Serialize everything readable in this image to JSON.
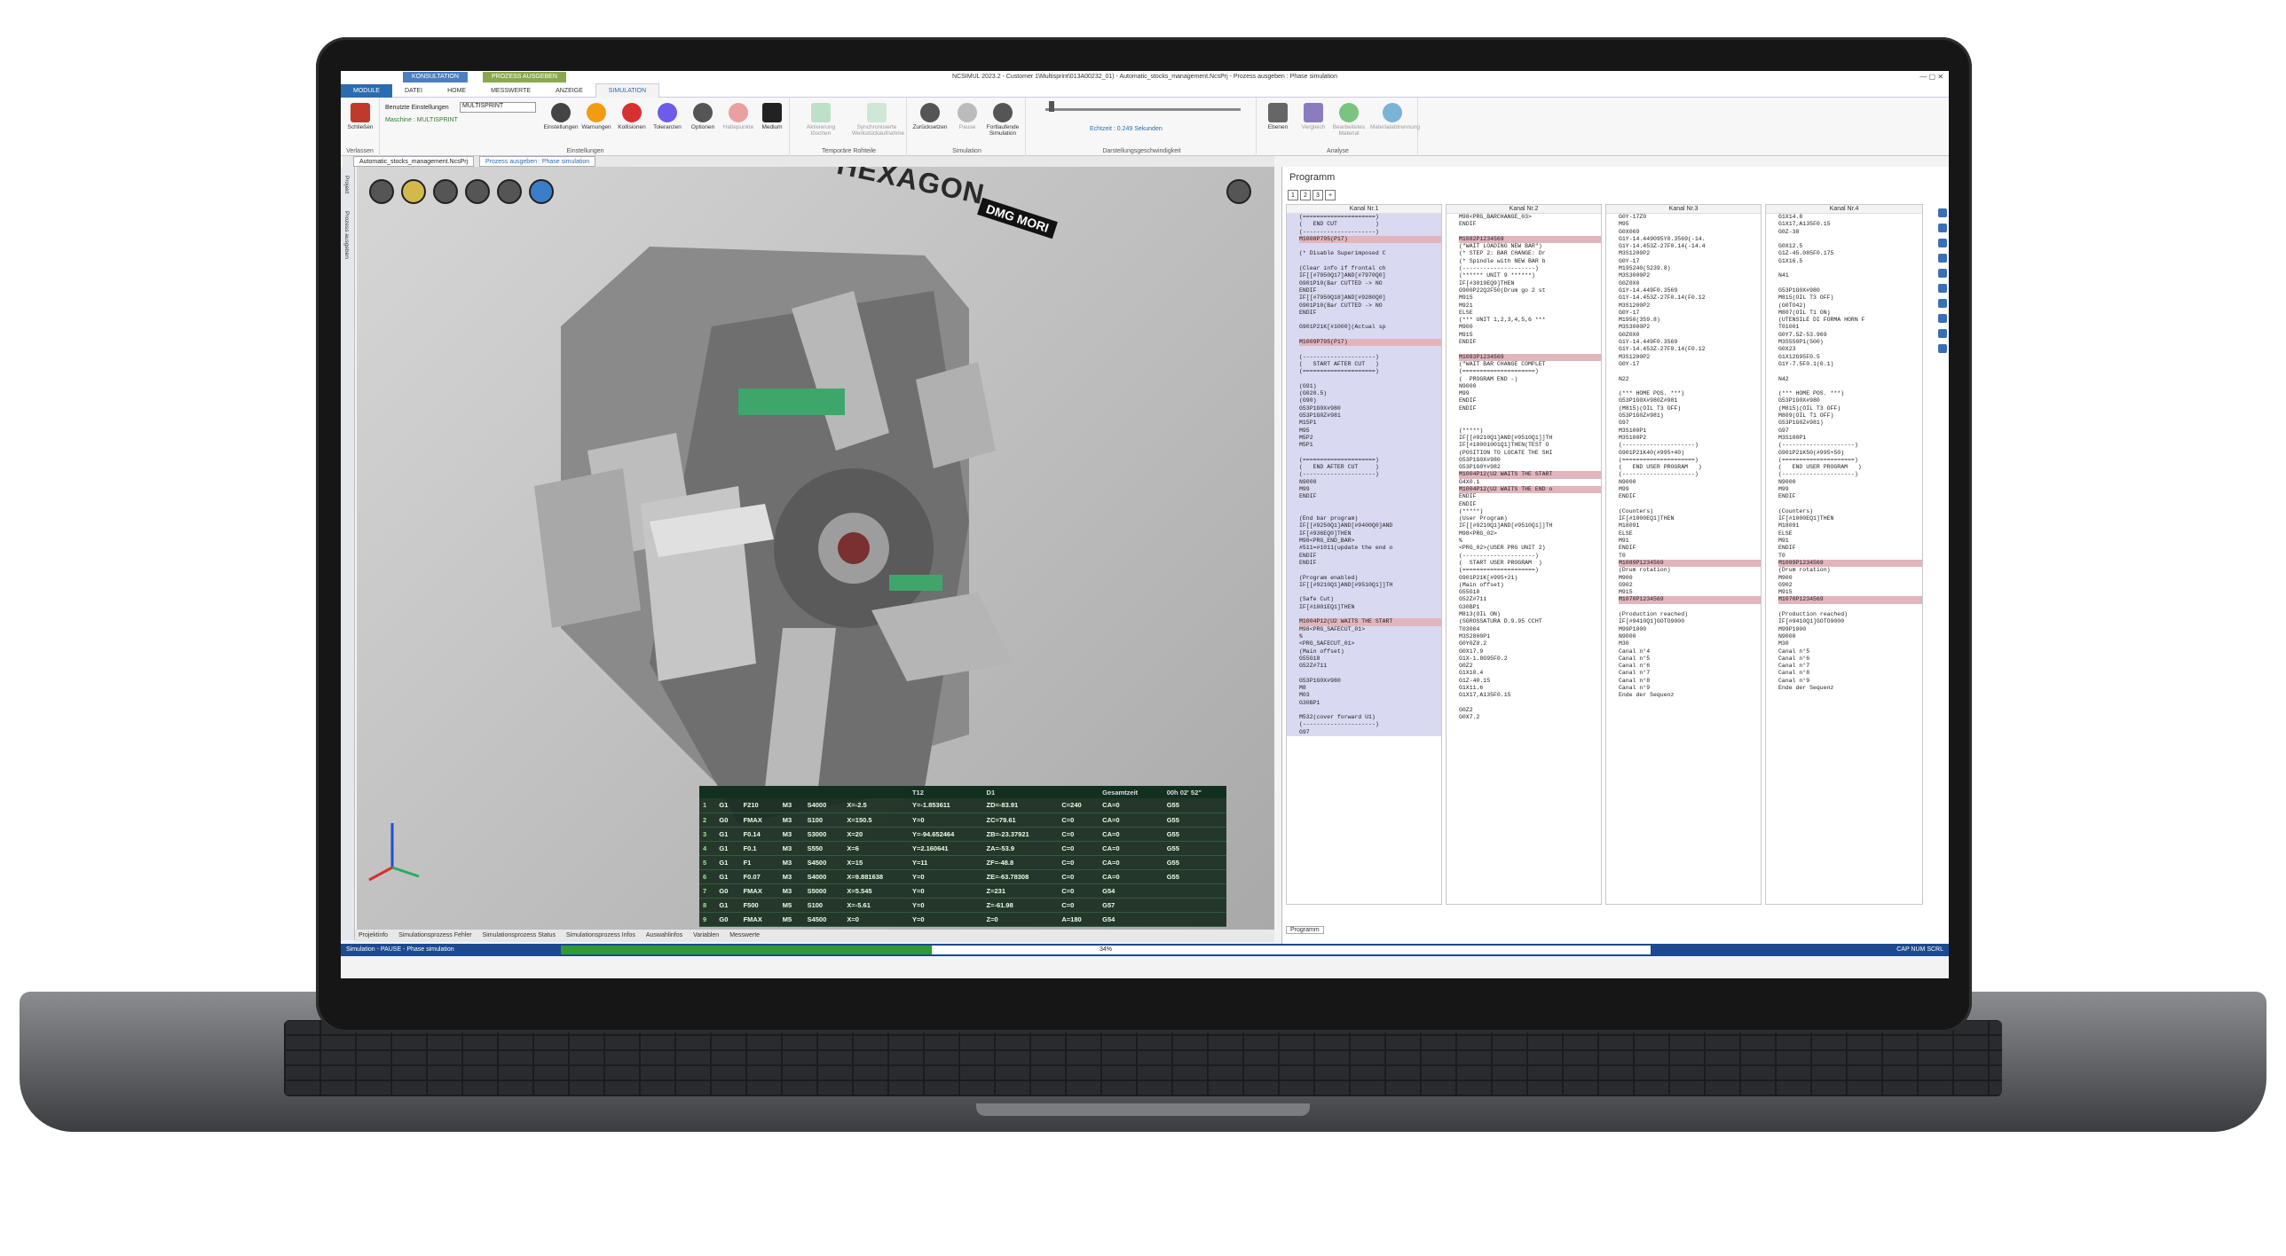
{
  "window": {
    "title": "NCSIMUL 2023.2 - Customer 1\\Multisprint\\013A00232_01) - Automatic_stocks_management.NcsPrj - Prozess ausgeben : Phase simulation",
    "context_tabs": [
      "KONSULTATION",
      "PROZESS AUSGEBEN"
    ]
  },
  "ribbon_tabs": [
    "MODULE",
    "DATEI",
    "HOME",
    "MESSWERTE",
    "ANZEIGE",
    "SIMULATION"
  ],
  "ribbon": {
    "close_label": "Schließen",
    "group_leave": "Verlassen",
    "used_settings_label": "Benutzte Einstellungen",
    "used_settings_value": "MULTISPRINT",
    "machine_label": "Maschine : MULTISPRINT",
    "settings_buttons": [
      "Einstellungen",
      "Warnungen",
      "Kollisionen",
      "Toleranzen",
      "Optionen",
      "Haltepunkte",
      "Medium"
    ],
    "group_settings": "Einstellungen",
    "stock_buttons": [
      "Aktivierung löschen",
      "Synchronisierte Werkstückaufnahme"
    ],
    "group_stock": "Temporäre Rohteile",
    "sim_buttons": [
      "Zurücksetzen",
      "Pause",
      "Fortlaufende Simulation"
    ],
    "group_sim": "Simulation",
    "speed_label": "Echtzeit : 0.249 Sekunden",
    "group_speed": "Darstellungsgeschwindigkeit",
    "analysis_buttons": [
      "Ebenen",
      "Vergleich",
      "Bearbeitetes Material",
      "Materialabtrennung"
    ],
    "group_analysis": "Analyse"
  },
  "doc_tabs": [
    "Automatic_stocks_management.NcsPrj",
    "Prozess ausgeben : Phase simulation"
  ],
  "left_strip": [
    "Projekt",
    "Prozess ausgeben"
  ],
  "viewport": {
    "brand1": "HEXAGON",
    "brand2": "DMG MORI",
    "table_header": [
      "",
      "",
      "",
      "",
      "",
      "",
      "T12",
      "D1",
      "",
      "Gesamtzeit",
      "00h 02' 52\""
    ],
    "rows": [
      [
        "1",
        "G1",
        "F210",
        "M3",
        "S4000",
        "X=-2.5",
        "Y=-1.853611",
        "ZD=-83.91",
        "C=240",
        "CA=0",
        "G55"
      ],
      [
        "2",
        "G0",
        "FMAX",
        "M3",
        "S100",
        "X=150.5",
        "Y=0",
        "ZC=79.61",
        "C=0",
        "CA=0",
        "G55"
      ],
      [
        "3",
        "G1",
        "F0.14",
        "M3",
        "S3000",
        "X=20",
        "Y=-94.652464",
        "ZB=-23.37921",
        "C=0",
        "CA=0",
        "G55"
      ],
      [
        "4",
        "G1",
        "F0.1",
        "M3",
        "S550",
        "X=6",
        "Y=2.160641",
        "ZA=-53.9",
        "C=0",
        "CA=0",
        "G55"
      ],
      [
        "5",
        "G1",
        "F1",
        "M3",
        "S4500",
        "X=15",
        "Y=11",
        "ZF=-48.8",
        "C=0",
        "CA=0",
        "G55"
      ],
      [
        "6",
        "G1",
        "F0.07",
        "M3",
        "S4000",
        "X=9.881638",
        "Y=0",
        "ZE=-63.78308",
        "C=0",
        "CA=0",
        "G55"
      ],
      [
        "7",
        "G0",
        "FMAX",
        "M3",
        "S5000",
        "X=5.545",
        "Y=0",
        "Z=231",
        "C=0",
        "G54",
        ""
      ],
      [
        "8",
        "G1",
        "F500",
        "M5",
        "S100",
        "X=-5.61",
        "Y=0",
        "Z=-61.98",
        "C=0",
        "G57",
        ""
      ],
      [
        "9",
        "G0",
        "FMAX",
        "M5",
        "S4500",
        "X=0",
        "Y=0",
        "Z=0",
        "A=180",
        "G54",
        ""
      ]
    ]
  },
  "bottom_tabs": [
    "Projektinfo",
    "Simulationsprozess Fehler",
    "Simulationsprozess Status",
    "Simulationsprozess Infos",
    "Auswahlinfos",
    "Variablen",
    "Messwerte"
  ],
  "status": {
    "text": "Simulation - PAUSE - Phase simulation",
    "progress_label": "34%",
    "progress_fraction": 0.34,
    "indicators": "CAP NUM SCRL"
  },
  "program": {
    "title": "Programm",
    "toolbar": [
      "1",
      "2",
      "3",
      "+"
    ],
    "bottom_tab": "Programm",
    "channels": [
      {
        "name": "Kanal Nr.1",
        "lines": [
          "(=====================)",
          "(   END CUT           )",
          "(---------------------)",
          "M1008P795(P17)",
          "",
          "(* Disable Superimposed C",
          "",
          "(Clear info if frontal ch",
          "IF[[#7950Q17]AND[#7970Q0]",
          "G901P10(Bar CUTTED -> NO",
          "ENDIF",
          "IF[[#7950Q18]AND[#9280Q0]",
          "G901P10(Bar CUTTED -> NO",
          "ENDIF",
          "",
          "G901P21K[#1000](Actual sp",
          "",
          "M1009P795(P17)",
          "",
          "(---------------------)",
          "(   START AFTER CUT   )",
          "(=====================)",
          "",
          "(G91)",
          "(G020.5)",
          "(G90)",
          "G53P1G0X#980",
          "G53P1G0Z#981",
          "M15P1",
          "M95",
          "M5P2",
          "M5P1",
          "",
          "(=====================)",
          "(   END AFTER CUT     )",
          "(---------------------)",
          "N9000",
          "M99",
          "ENDIF",
          "",
          "",
          "(End bar program)",
          "IF[[#9250Q1]AND[#9400Q0]AND",
          "IF[#936EQ0]THEN",
          "M98<PRG_END_BAR>",
          "#511=#1011(update the end o",
          "ENDIF",
          "ENDIF",
          "",
          "(Program enabled)",
          "IF[[#9210Q1]AND[#9510Q1]]TH",
          "",
          "(Safe Cut)",
          "IF[#1001EQ1]THEN",
          "",
          "M1004P12(U2 WAITS THE START",
          "M98<PRG_SAFECUT_01>",
          "%",
          "<PRG_SAFECUT_01>",
          "(Main offset)",
          "G55G18",
          "G52Z#711",
          "",
          "G53P1G0X#980",
          "M8",
          "M03",
          "G30BP1",
          "",
          "M532(cover forward U1)",
          "(---------------------)",
          "G97"
        ]
      },
      {
        "name": "Kanal Nr.2",
        "lines": [
          "M98<PRG_BARCHANGE_03>",
          "ENDIF",
          "",
          "M1082P1234569",
          "(\"WAIT LOADING NEW BAR\")",
          "(* STEP 2: BAR CHANGE: Dr",
          "(* Spindle with NEW BAR b",
          "(---------------------)",
          "(****** UNIT 9 ******)",
          "IF[#3019EQ9]THEN",
          "G900P22Q2F50(Drum go 2 st",
          "M915",
          "M921",
          "ELSE",
          "(*** UNIT 1,2,3,4,5,6 ***",
          "M900",
          "M915",
          "ENDIF",
          "",
          "M1083P1234569",
          "(\"WAIT BAR CHANGE COMPLET",
          "(=====================)",
          "(  PROGRAM END -)",
          "N9000",
          "M99",
          "ENDIF",
          "ENDIF",
          "",
          "",
          "(*****)",
          "IF[[#9210Q1]AND[#9510Q1]]TH",
          "IF[#10001001Q1]THEN(TEST O",
          "(POSITION TO LOCATE THE SHI",
          "G53P1G0X#980",
          "G53P1G0Y#982",
          "M1004P12(U2 WAITS THE START",
          "G4X0.1",
          "M1004P12(U2 WAITS THE END o",
          "ENDIF",
          "ENDIF",
          "(*****)",
          "(User Program)",
          "IF[[#9210Q1]AND[#9510Q1]]TH",
          "M98<PRG_02>",
          "%",
          "<PRG_02>(USER PRG UNIT 2)",
          "(---------------------)",
          "(  START USER PROGRAM  )",
          "(=====================)",
          "G901P21K[#995+21)",
          "(Main offset)",
          "G55G18",
          "G52Z#711",
          "G30BP1",
          "M813(OIL ON)",
          "(SGROSSATURA D.9.95 CCHT",
          "T03004",
          "M3S2800P1",
          "G0Y0Z0.2",
          "G0X17.9",
          "G1X-1.8G95F0.2",
          "G0Z2",
          "G1X10.4",
          "G1Z-40.15",
          "G1X11.6",
          "G1X17,A135F0.15",
          "",
          "G0Z2",
          "G0X7.2"
        ]
      },
      {
        "name": "Kanal Nr.3",
        "lines": [
          "G0Y-17Z0",
          "M95",
          "G0X069",
          "G1Y-14.449095Y0.3569(-14.",
          "G1Y-14.453Z-27F0.14(-14.4",
          "M3S1200P2",
          "G0Y-17",
          "M195240(S239.8)",
          "M3S3000P2",
          "G0Z0X0",
          "G1Y-14.449F0.3569",
          "G1Y-14.453Z-27F0.14(F0.12",
          "M3S1200P2",
          "G0Y-17",
          "M1950(359.8)",
          "M3S3000P2",
          "G0Z0X0",
          "G1Y-14.449F0.3569",
          "G1Y-14.453Z-27F0.14(F0.12",
          "M3S1200P2",
          "G0Y-17",
          "",
          "N22",
          "",
          "(*** HOME POS. ***)",
          "G53P1G0X#980Z#981",
          "(M815)(OIL T3 OFF)",
          "G53P1G0Z#981)",
          "G97",
          "M3S100P1",
          "M3S100P2",
          "(---------------------)",
          "G901P21K40(#995+40)",
          "(=====================)",
          "(   END USER PROGRAM   )",
          "(---------------------)",
          "N9000",
          "M99",
          "ENDIF",
          "",
          "(Counters)",
          "IF[#1000EQ1]THEN",
          "M18091",
          "ELSE",
          "M91",
          "ENDIF",
          "T0",
          "M1089P1234569",
          "(Drum rotation)",
          "M900",
          "G902",
          "M915",
          "M1070P1234569",
          "",
          "(Production reached)",
          "IF[#9410Q1]GOTO9000",
          "M99P1000",
          "N9000",
          "M30",
          "Canal n°4",
          "Canal n°5",
          "Canal n°6",
          "Canal n°7",
          "Canal n°8",
          "Canal n°9",
          "Ende der Sequenz"
        ]
      },
      {
        "name": "Kanal Nr.4",
        "lines": [
          "G1X14.8",
          "G1X17,A135F0.15",
          "G0Z-38",
          "",
          "G0X12.5",
          "G1Z-45.085F0.175",
          "G1X16.5",
          "",
          "N41",
          "",
          "G53P1G0X#980",
          "M815(OIL T3 OFF)",
          "(G0TO42)",
          "M807(OIL T1 ON)",
          "(UTENSILE DI FORMA HORN F",
          "T01001",
          "G0Y7.5Z-53.969",
          "M3S550P1(500)",
          "G0X23",
          "G1X12G95F0.5",
          "G1Y-7.5F0.1(0.1)",
          "",
          "N42",
          "",
          "(*** HOME POS. ***)",
          "G53P1G0X#980",
          "(M815)(OIL T3 OFF)",
          "M809(OIL T1 OFF)",
          "G53P1G0Z#981)",
          "G97",
          "M3S100P1",
          "(---------------------)",
          "G901P21K50(#995+50)",
          "(=====================)",
          "(   END USER PROGRAM   )",
          "(---------------------)",
          "N9000",
          "M99",
          "ENDIF",
          "",
          "(Counters)",
          "IF[#1000EQ1]THEN",
          "M18091",
          "ELSE",
          "M91",
          "ENDIF",
          "T0",
          "M1089P1234569",
          "(Drum rotation)",
          "M900",
          "G902",
          "M915",
          "M1070P1234569",
          "",
          "(Production reached)",
          "IF[#9410Q1]GOTO9000",
          "M99P1000",
          "N9000",
          "M30",
          "Canal n°5",
          "Canal n°6",
          "Canal n°7",
          "Canal n°8",
          "Canal n°9",
          "Ende der Sequenz"
        ]
      }
    ]
  }
}
